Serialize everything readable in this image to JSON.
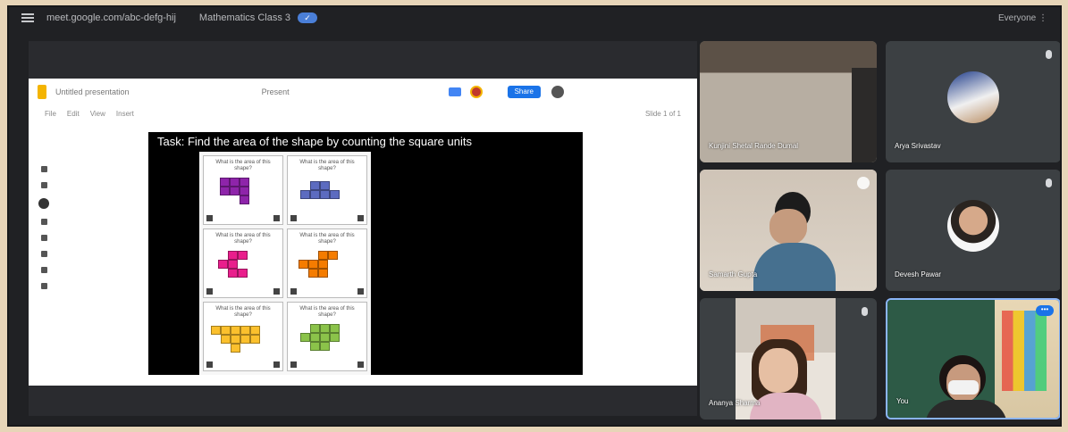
{
  "topbar": {
    "url": "meet.google.com/abc-defg-hij",
    "meeting_name": "Mathematics Class 3",
    "verified_label": "✓",
    "right_text": "Everyone ⋮"
  },
  "slides": {
    "doc_title": "Untitled presentation",
    "present_label": "Present",
    "share_label": "Share",
    "toolbar_items": [
      "File",
      "Edit",
      "View",
      "Insert"
    ],
    "toolbar_right": "Slide 1 of 1",
    "task_text": "Task: Find the area of the shape by counting the square units",
    "cards": [
      {
        "text": "What is the area of this shape?",
        "color": "#8e24aa"
      },
      {
        "text": "What is the area of this shape?",
        "color": "#5c6bc0"
      },
      {
        "text": "What is the area of this shape?",
        "color": "#e91e8c"
      },
      {
        "text": "What is the area of this shape?",
        "color": "#f57c00"
      },
      {
        "text": "What is the area of this shape?",
        "color": "#fbc02d"
      },
      {
        "text": "What is the area of this shape?",
        "color": "#8bc34a"
      }
    ]
  },
  "participants": [
    {
      "name": "Kunjini Shetal Rande Dumal"
    },
    {
      "name": "Arya Srivastav"
    },
    {
      "name": "Samarth Gupta"
    },
    {
      "name": "Devesh Pawar"
    },
    {
      "name": "Ananya Sharma"
    },
    {
      "name": "You",
      "more_label": "•••"
    }
  ],
  "colors": {
    "background": "#e7d5b8",
    "meet_bg": "#202124",
    "tile_bg": "#3c4043",
    "accent": "#1a73e8"
  }
}
